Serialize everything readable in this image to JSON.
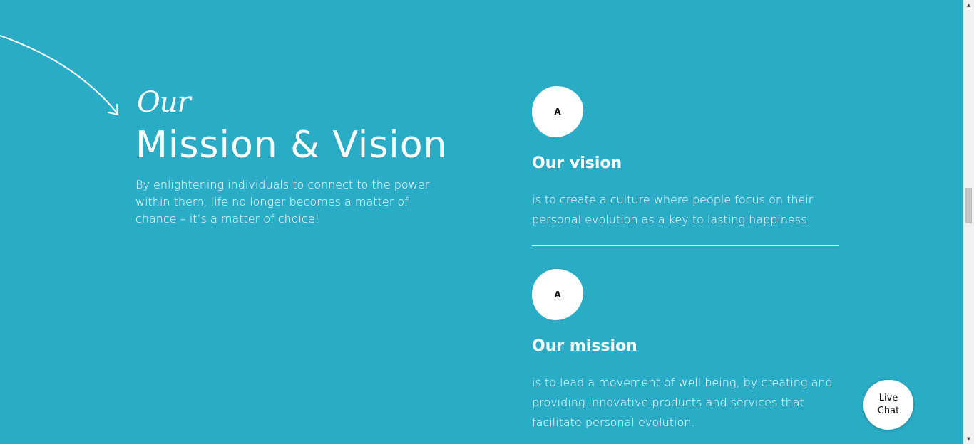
{
  "intro": {
    "script_word": "Our",
    "heading": "Mission & Vision",
    "lead": "By enlightening individuals to connect to the power within them, life no longer becomes a matter of chance – it’s a matter of choice!"
  },
  "cards": [
    {
      "icon_letter": "A",
      "title": "Our vision",
      "text": "is to create a culture where people focus on their personal evolution as a key to lasting happiness."
    },
    {
      "icon_letter": "A",
      "title": "Our mission",
      "text": "is to lead a movement of well being, by creating and providing innovative products and services that facilitate personal evolution."
    }
  ],
  "live_chat": {
    "line1": "Live",
    "line2": "Chat"
  },
  "colors": {
    "background": "#2aacc6",
    "text": "#ffffff"
  }
}
